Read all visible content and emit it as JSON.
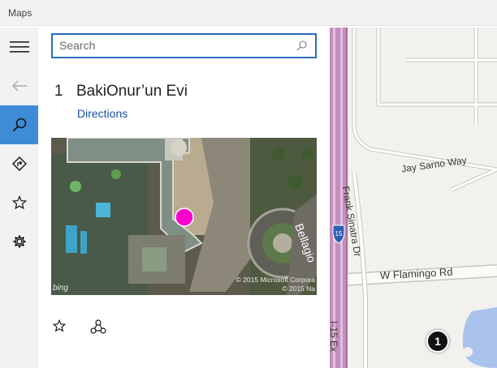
{
  "window": {
    "title": "Maps"
  },
  "rail": {
    "items": [
      {
        "icon": "hamburger-menu-icon"
      },
      {
        "icon": "back-arrow-icon"
      },
      {
        "icon": "search-icon",
        "active": true
      },
      {
        "icon": "directions-icon"
      },
      {
        "icon": "favorites-star-icon"
      },
      {
        "icon": "settings-gear-icon"
      }
    ],
    "active_color": "#3e8bd6"
  },
  "search": {
    "placeholder": "Search",
    "value": ""
  },
  "result": {
    "number": "1",
    "name": "BakiOnur’un Evi",
    "directions_label": "Directions",
    "aerial": {
      "watermark": "bing",
      "copyright_1": "© 2015 Microsoft Corpora",
      "copyright_2": "© 2015 Na",
      "street_label": "Bellagio",
      "marker_color": "#ff00cc"
    },
    "actions": [
      {
        "icon": "favorite-star-icon"
      },
      {
        "icon": "share-icon"
      }
    ]
  },
  "map": {
    "labels": {
      "jay_sarno": "Jay Sarno Way",
      "frank_sinatra": "Frank Sinatra Dr",
      "flamingo": "W Flamingo Rd",
      "i15_shield": "15",
      "i15_road": "I-15 Ex"
    },
    "pin_label": "1"
  }
}
